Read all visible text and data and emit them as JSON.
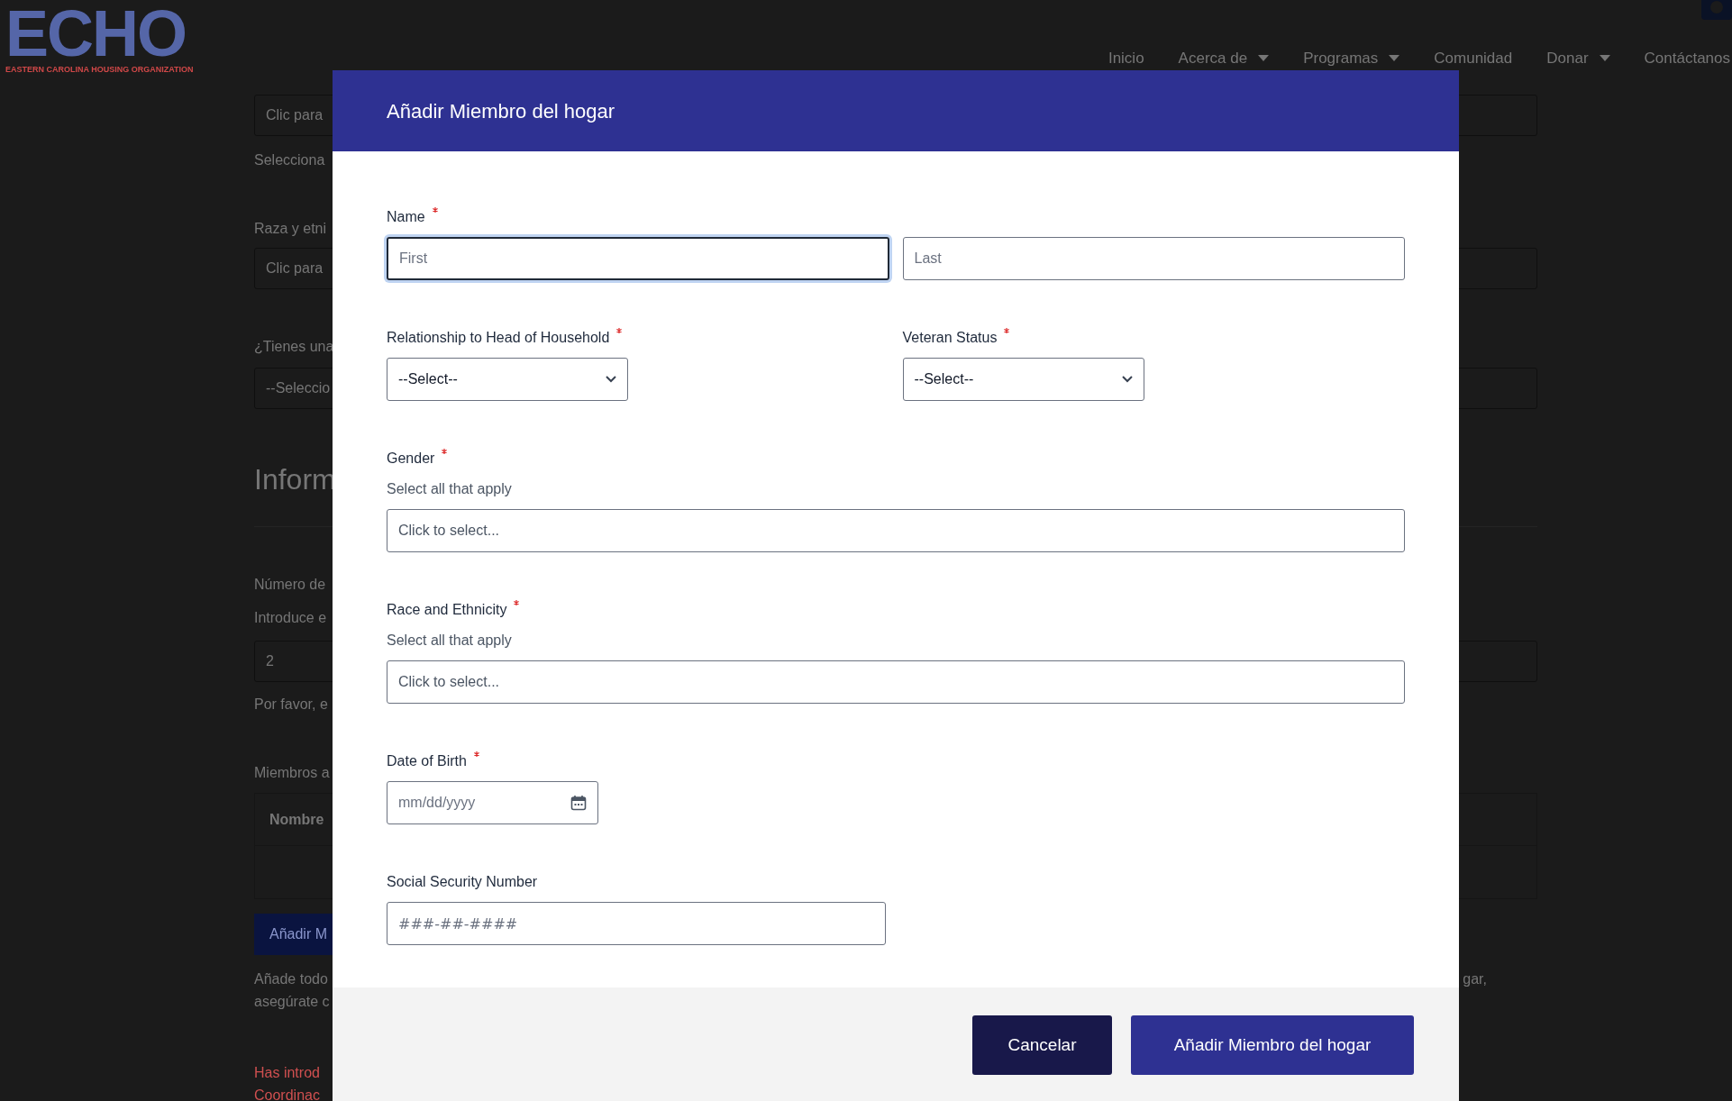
{
  "page": {
    "logo": {
      "wordmark": "ECHO",
      "tagline": "EASTERN CAROLINA HOUSING ORGANIZATION"
    },
    "nav": [
      {
        "label": "Inicio",
        "has_menu": false
      },
      {
        "label": "Acerca de",
        "has_menu": true
      },
      {
        "label": "Programas",
        "has_menu": true
      },
      {
        "label": "Comunidad",
        "has_menu": false
      },
      {
        "label": "Donar",
        "has_menu": true
      },
      {
        "label": "Contáctanos",
        "has_menu": false
      }
    ],
    "content": [
      {
        "kind": "input",
        "text": "Clic para"
      },
      {
        "kind": "note",
        "lines": [
          "Selecciona"
        ]
      },
      {
        "kind": "label",
        "text": "Raza y etni"
      },
      {
        "kind": "input",
        "text": "Clic para"
      },
      {
        "kind": "label",
        "text": "¿Tienes una"
      },
      {
        "kind": "select",
        "text": "--Seleccio"
      },
      {
        "kind": "heading",
        "text": "Inform"
      },
      {
        "kind": "label",
        "text": "Número de"
      },
      {
        "kind": "note",
        "lines": [
          "Introduce e"
        ]
      },
      {
        "kind": "value",
        "text": "2"
      },
      {
        "kind": "note",
        "lines": [
          "Por favor, e"
        ]
      },
      {
        "kind": "label",
        "text": "Miembros a"
      },
      {
        "kind": "table",
        "text": "Nombre"
      },
      {
        "kind": "button",
        "text": "Añadir M"
      },
      {
        "kind": "note",
        "lines": [
          "Añade todo",
          "asegúrate c"
        ],
        "right_fragment": "gar,"
      },
      {
        "kind": "error",
        "lines": [
          "Has introd",
          "Coordinac"
        ]
      }
    ]
  },
  "modal": {
    "title": "Añadir Miembro del hogar",
    "rows": [
      {
        "fields": [
          {
            "kind": "name",
            "label": "Name",
            "required": true,
            "parts": [
              {
                "placeholder": "First",
                "focused": true
              },
              {
                "placeholder": "Last",
                "focused": false
              }
            ]
          }
        ]
      },
      {
        "fields": [
          {
            "kind": "select",
            "label": "Relationship to Head of Household",
            "required": true,
            "value": "--Select--"
          },
          {
            "kind": "select",
            "label": "Veteran Status",
            "required": true,
            "value": "--Select--"
          }
        ]
      },
      {
        "fields": [
          {
            "kind": "multiselect",
            "label": "Gender",
            "required": true,
            "helper": "Select all that apply",
            "placeholder": "Click to select..."
          }
        ]
      },
      {
        "fields": [
          {
            "kind": "multiselect",
            "label": "Race and Ethnicity",
            "required": true,
            "helper": "Select all that apply",
            "placeholder": "Click to select..."
          }
        ]
      },
      {
        "fields": [
          {
            "kind": "date",
            "label": "Date of Birth",
            "required": true,
            "placeholder": "mm/dd/yyyy"
          }
        ]
      },
      {
        "fields": [
          {
            "kind": "text",
            "label": "Social Security Number",
            "required": false,
            "placeholder": "###-##-####"
          }
        ]
      }
    ],
    "buttons": [
      {
        "label": "Cancelar",
        "kind": "secondary"
      },
      {
        "label": "Añadir Miembro del hogar",
        "kind": "primary"
      }
    ]
  }
}
